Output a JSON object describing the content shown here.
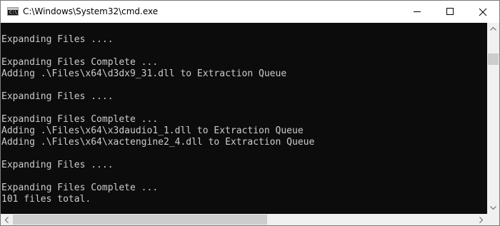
{
  "window": {
    "title": "C:\\Windows\\System32\\cmd.exe",
    "icon_prompt": "C:\\"
  },
  "title_buttons": {
    "minimize_icon": "minimize-icon",
    "maximize_icon": "maximize-icon",
    "close_icon": "close-icon"
  },
  "console": {
    "background": "#0c0c0c",
    "text_color": "#cccccc",
    "lines": [
      "",
      "Expanding Files ....",
      "",
      "Expanding Files Complete ...",
      "Adding .\\Files\\x64\\d3dx9_31.dll to Extraction Queue",
      "",
      "Expanding Files ....",
      "",
      "Expanding Files Complete ...",
      "Adding .\\Files\\x64\\x3daudio1_1.dll to Extraction Queue",
      "Adding .\\Files\\x64\\xactengine2_4.dll to Extraction Queue",
      "",
      "Expanding Files ....",
      "",
      "Expanding Files Complete ...",
      "101 files total.",
      ""
    ]
  },
  "scrollbars": {
    "vertical_position": 0.12,
    "vertical_visible_fraction": 0.07,
    "horizontal_position": 0.0,
    "horizontal_visible_fraction": 0.55
  }
}
